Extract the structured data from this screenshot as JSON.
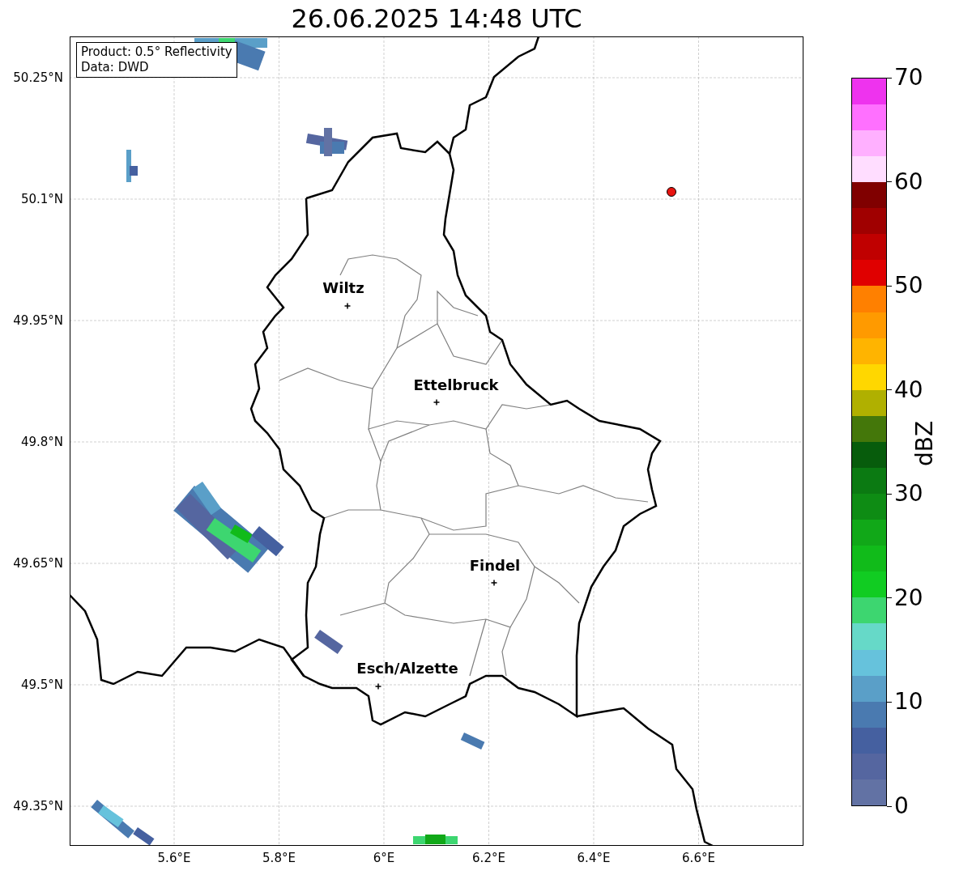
{
  "title": "26.06.2025 14:48 UTC",
  "legend": [
    "Product: 0.5° Reflectivity",
    "Data: DWD"
  ],
  "y_ticks": [
    "50.25°N",
    "50.1°N",
    "49.95°N",
    "49.8°N",
    "49.65°N",
    "49.5°N",
    "49.35°N"
  ],
  "x_ticks": [
    "5.6°E",
    "5.8°E",
    "6°E",
    "6.2°E",
    "6.4°E",
    "6.6°E"
  ],
  "cities": [
    {
      "name": "Wiltz"
    },
    {
      "name": "Ettelbruck"
    },
    {
      "name": "Findel"
    },
    {
      "name": "Esch/Alzette"
    }
  ],
  "colorbar": {
    "label": "dBZ",
    "ticks": [
      "70",
      "60",
      "50",
      "40",
      "30",
      "20",
      "10",
      "0"
    ],
    "bands": [
      {
        "color": "#6272a4"
      },
      {
        "color": "#5566a0"
      },
      {
        "color": "#4560a0"
      },
      {
        "color": "#4a7ab0"
      },
      {
        "color": "#5a9fc8"
      },
      {
        "color": "#66c2dc"
      },
      {
        "color": "#66d9c8"
      },
      {
        "color": "#3dd670"
      },
      {
        "color": "#11cc22"
      },
      {
        "color": "#11bb1a"
      },
      {
        "color": "#11a818"
      },
      {
        "color": "#0e8c14"
      },
      {
        "color": "#0b7a12"
      },
      {
        "color": "#075c0c"
      },
      {
        "color": "#44770a"
      },
      {
        "color": "#b0b000"
      },
      {
        "color": "#ffd700"
      },
      {
        "color": "#ffb400"
      },
      {
        "color": "#ff9a00"
      },
      {
        "color": "#ff8000"
      },
      {
        "color": "#e00000"
      },
      {
        "color": "#c00000"
      },
      {
        "color": "#a00000"
      },
      {
        "color": "#800000"
      },
      {
        "color": "#ffddff"
      },
      {
        "color": "#ffb0ff"
      },
      {
        "color": "#ff70ff"
      },
      {
        "color": "#ee33ee"
      }
    ]
  }
}
